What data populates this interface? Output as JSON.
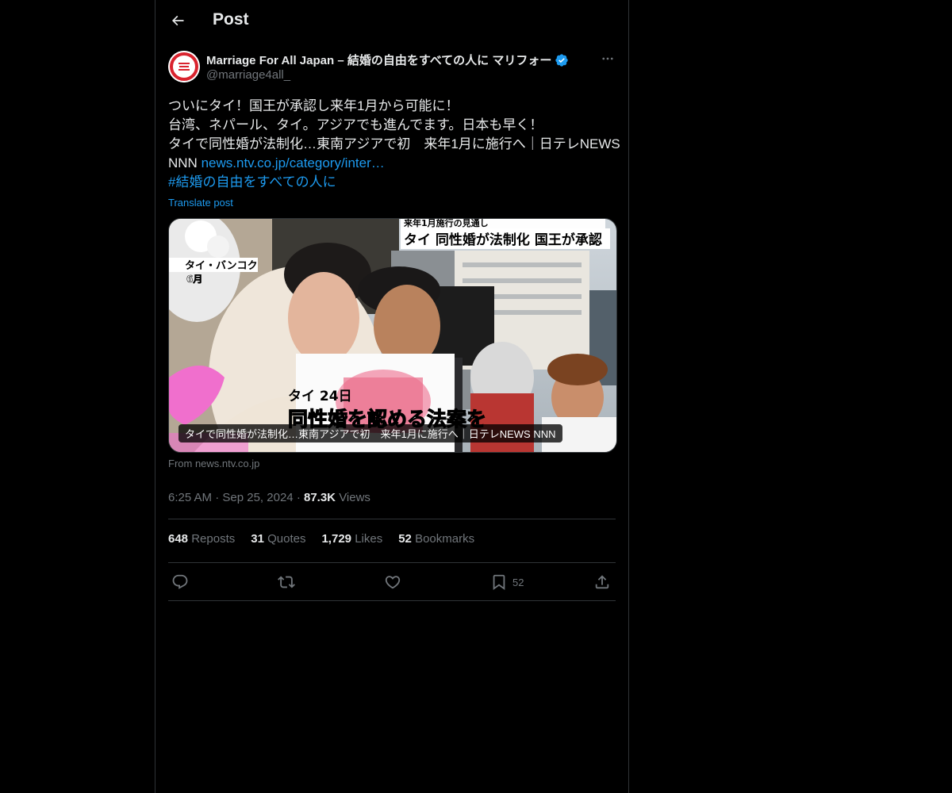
{
  "header": {
    "title": "Post"
  },
  "author": {
    "name": "Marriage For All Japan – 結婚の自由をすべての人に マリフォー",
    "handle": "@marriage4all_",
    "verified": true
  },
  "post": {
    "line1": "ついにタイ！国王が承認し来年1月から可能に！",
    "line2": "台湾、ネパール、タイ。アジアでも進んでます。日本も早く！",
    "line3": "タイで同性婚が法制化…東南アジアで初　来年1月に施行へ｜日テレNEWS",
    "line4_prefix": "NNN",
    "link": "news.ntv.co.jp/category/inter…",
    "hashtag": "#結婚の自由をすべての人に",
    "translate": "Translate post"
  },
  "card": {
    "caption": "タイで同性婚が法制化…東南アジアで初　来年1月に施行へ｜日テレNEWS NNN",
    "source": "From news.ntv.co.jp",
    "image_text": {
      "banner_small": "来年1月施行の見通し",
      "banner_big": "タイ 同性婚が法制化 国王が承認",
      "location": "タイ・バンコク",
      "month": "6月",
      "date_tag": "タイ  24日",
      "headline": "同性婚を認める法案を"
    }
  },
  "meta": {
    "time": "6:25 AM",
    "date": "Sep 25, 2024",
    "views_count": "87.3K",
    "views_label": "Views"
  },
  "stats": {
    "reposts_count": "648",
    "reposts_label": "Reposts",
    "quotes_count": "31",
    "quotes_label": "Quotes",
    "likes_count": "1,729",
    "likes_label": "Likes",
    "bookmarks_count": "52",
    "bookmarks_label": "Bookmarks"
  },
  "actions": {
    "bookmark_count": "52"
  },
  "icons": [
    "back-arrow-icon",
    "verified-badge-icon",
    "more-icon",
    "reply-icon",
    "repost-icon",
    "like-icon",
    "bookmark-icon",
    "share-icon"
  ],
  "colors": {
    "background": "#000000",
    "link": "#1d9bf0",
    "verified": "#1d9bf0",
    "muted": "#71767b",
    "text": "#e7e9ea"
  }
}
